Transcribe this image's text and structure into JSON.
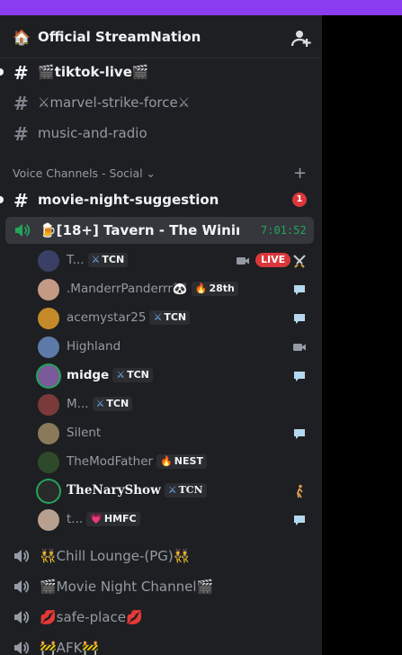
{
  "server": {
    "name": "Official StreamNation",
    "icon": "house-icon"
  },
  "channels": [
    {
      "label": "🎬tiktok-live🎬",
      "bright": true,
      "unread": true
    },
    {
      "label": "⚔marvel-strike-force⚔",
      "bright": false,
      "unread": false
    },
    {
      "label": "music-and-radio",
      "bright": false,
      "unread": false
    }
  ],
  "category": {
    "label": "Voice Channels - Social ⌄"
  },
  "suggestion_channel": {
    "label": "movie-night-suggestion",
    "mentions": "1"
  },
  "active_voice": {
    "label": "🍺[18+] Tavern - The Wining W...",
    "timer": "7:01:52"
  },
  "voice_users": [
    {
      "name": "T...",
      "tag": "TCN",
      "tag_icon": "⚔",
      "bold": false,
      "live": "LIVE",
      "status": [
        "camera-icon",
        "swords-icon"
      ],
      "avatar": "#3a3f66"
    },
    {
      "name": ".ManderrPanderrr🐼",
      "tag": "28th",
      "tag_icon": "🔥",
      "bold": false,
      "status": [
        "chat-bubble-icon"
      ],
      "avatar": "#c49a84"
    },
    {
      "name": "acemystar25",
      "tag": "TCN",
      "tag_icon": "⚔",
      "bold": false,
      "status": [
        "chat-bubble-icon"
      ],
      "avatar": "#c48a2a"
    },
    {
      "name": "Highland",
      "tag": "",
      "tag_icon": "",
      "bold": false,
      "status": [
        "camera-icon"
      ],
      "avatar": "#5d7aa8"
    },
    {
      "name": "midge",
      "tag": "TCN",
      "tag_icon": "⚔",
      "bold": true,
      "speaking": true,
      "status": [
        "chat-bubble-icon"
      ],
      "avatar": "#7a5a9a"
    },
    {
      "name": "M...",
      "tag": "TCN",
      "tag_icon": "⚔",
      "bold": false,
      "status": [],
      "avatar": "#7a3a3a"
    },
    {
      "name": "Silent",
      "tag": "",
      "tag_icon": "",
      "bold": false,
      "status": [
        "chat-bubble-icon"
      ],
      "avatar": "#8a7a5a"
    },
    {
      "name": "TheModFather",
      "tag": "NEST",
      "tag_icon": "🔥",
      "bold": false,
      "status": [],
      "avatar": "#2f4a2a"
    },
    {
      "name": "TheNaryShow",
      "tag": "TCN",
      "tag_icon": "⚔",
      "bold": true,
      "fancy": true,
      "speaking": true,
      "status": [
        "walking-icon"
      ],
      "avatar": "#2a2a2a"
    },
    {
      "name": "t...",
      "tag": "HMFC",
      "tag_icon": "💗",
      "bold": false,
      "status": [
        "chat-bubble-icon"
      ],
      "avatar": "#b8a090"
    }
  ],
  "voice_channels": [
    {
      "label": "👯Chill Lounge-(PG)👯"
    },
    {
      "label": "🎬Movie Night Channel🎬"
    },
    {
      "label": "💋safe-place💋"
    },
    {
      "label": "🚧AFK🚧"
    }
  ],
  "colors": {
    "accent_strip": "#8a3cf0",
    "sidebar_bg": "#1e1f22",
    "speaking_green": "#23a55a",
    "live_red": "#da373c"
  }
}
